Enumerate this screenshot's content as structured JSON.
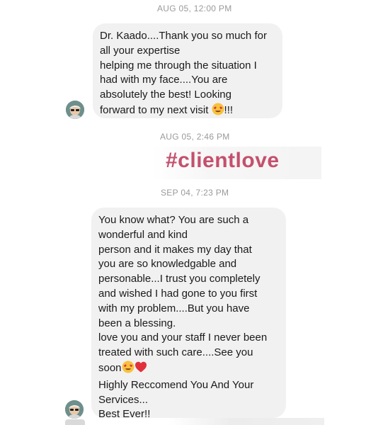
{
  "conversation": {
    "timestamps": {
      "first": "AUG 05, 12:00 PM",
      "second": "AUG 05, 2:46 PM",
      "third": "SEP 04, 7:23 PM"
    },
    "messages": [
      {
        "lines": [
          "Dr. Kaado....Thank you so much for",
          "all your expertise",
          "helping me  through the situation I",
          "had with my face....You are",
          "absolutely the best!  Looking",
          "forward to my next visit ",
          "!!!"
        ]
      },
      {
        "lines": [
          "You know what? You are such a",
          "wonderful and kind",
          "person and it makes my day that",
          "you are so knowledgable and",
          "personable...I trust you completely",
          "and wished I had gone to you first",
          "with my problem....But you have",
          "been a blessing.",
          "love you and your staff I never been",
          "treated with such care....See you",
          "soon",
          "Highly Reccomend You And Your",
          "Services...",
          "Best Ever!!"
        ]
      }
    ],
    "overlay_hashtag": "#clientlove"
  },
  "icons": {
    "heart_eyes": "heart-eyes-emoji",
    "red_heart": "red-heart-emoji",
    "avatar": "user-avatar"
  },
  "colors": {
    "bubble_bg": "#f1f1f2",
    "timestamp": "#9a9a9a",
    "hashtag": "#c4506d"
  }
}
